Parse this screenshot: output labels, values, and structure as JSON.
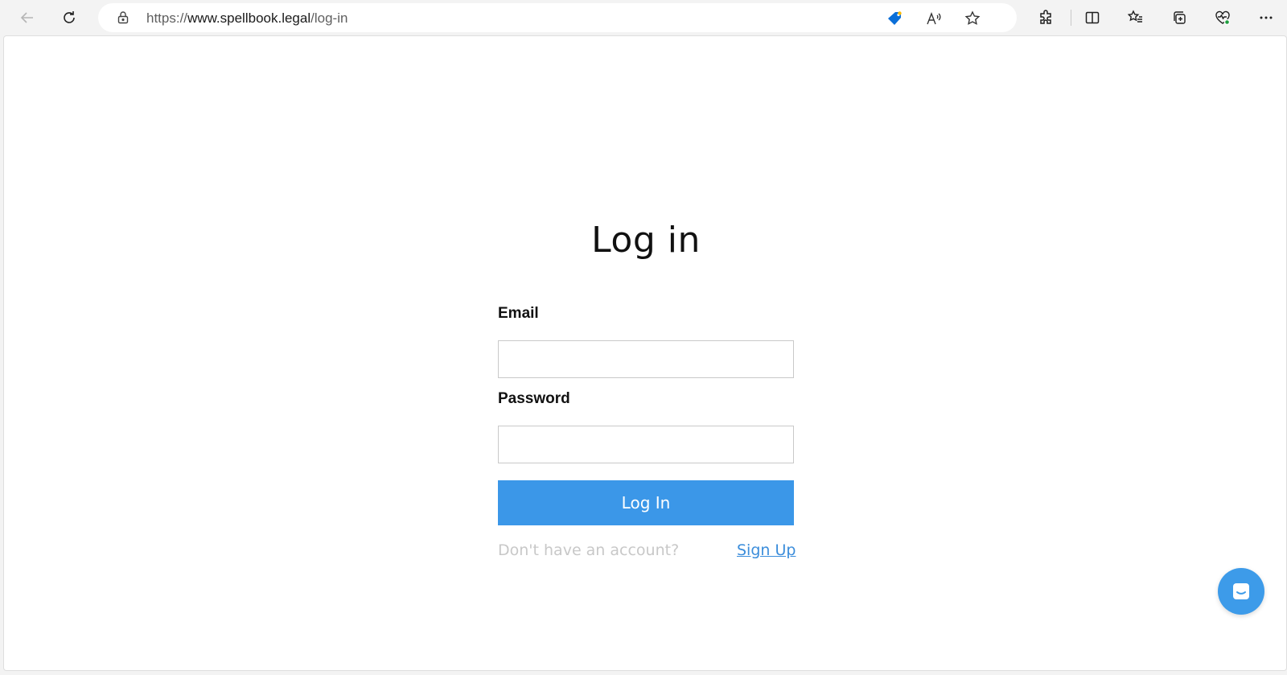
{
  "browser": {
    "url_scheme": "https://",
    "url_host": "www.spellbook.legal",
    "url_path": "/log-in",
    "icons": [
      "back-icon",
      "refresh-icon",
      "lock-icon",
      "tag-icon",
      "read-aloud-icon",
      "favorite-star-icon",
      "extensions-icon",
      "split-screen-icon",
      "favorites-list-icon",
      "collections-icon",
      "browser-essentials-icon",
      "more-icon"
    ],
    "accent": "#0b6fd8"
  },
  "page": {
    "title": "Log in",
    "email_label": "Email",
    "email_value": "",
    "password_label": "Password",
    "password_value": "",
    "login_button": "Log In",
    "no_account_prompt": "Don't have an account?",
    "signup_link": "Sign Up",
    "button_color": "#3b97e8",
    "link_color": "#3b8ddb"
  },
  "widget": {
    "icon": "chat-icon",
    "color": "#3d9be9"
  }
}
